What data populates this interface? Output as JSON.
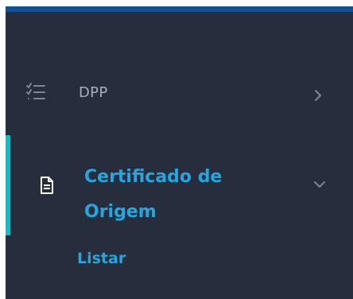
{
  "colors": {
    "sidebar_bg": "#262d3c",
    "top_bar": "#124f95",
    "active_indicator": "#19b8c4",
    "active_text": "#26a6e0",
    "inactive_text": "#a8aebb"
  },
  "menu": {
    "items": [
      {
        "label": "DPP",
        "icon": "checklist-icon",
        "state": "collapsed",
        "chevron": "chevron-right-icon"
      },
      {
        "label": "Certificado de Origem",
        "icon": "document-icon",
        "state": "expanded",
        "chevron": "chevron-down-icon",
        "sub_items": [
          {
            "label": "Listar"
          }
        ]
      }
    ]
  }
}
